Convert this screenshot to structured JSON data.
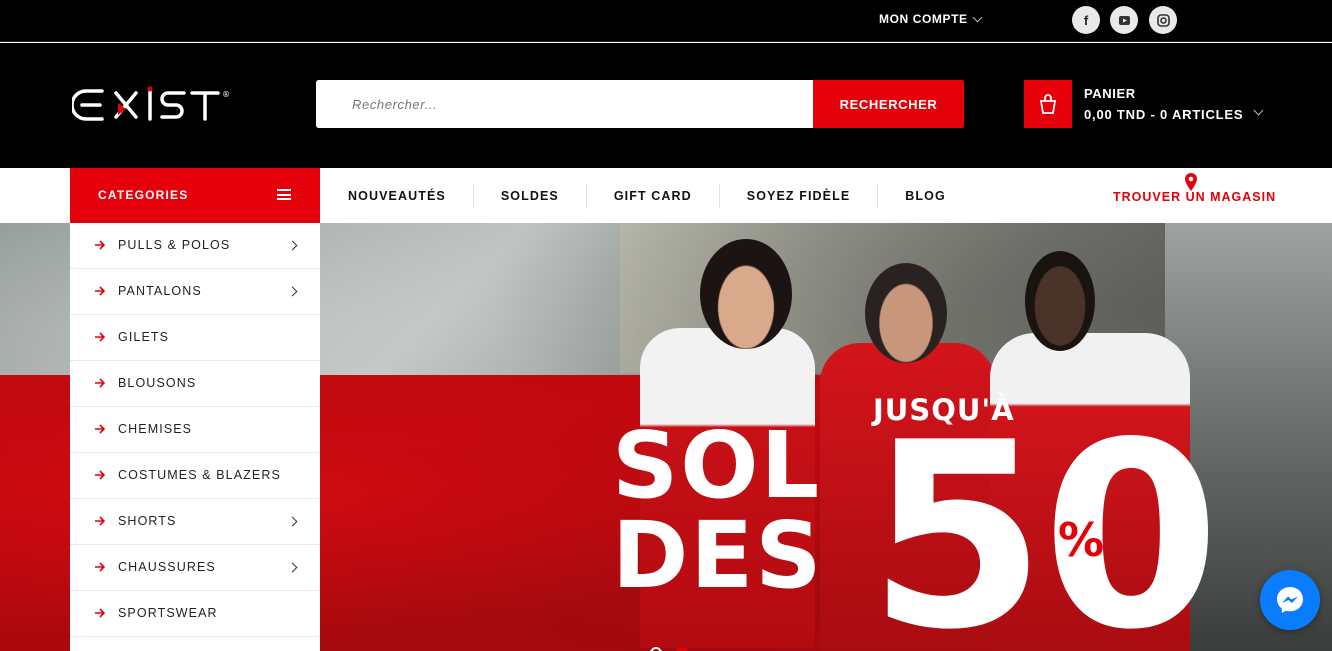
{
  "topbar": {
    "account_label": "MON COMPTE",
    "social": [
      {
        "icon": "facebook-icon",
        "glyph": "f"
      },
      {
        "icon": "youtube-icon",
        "glyph": "▶"
      },
      {
        "icon": "instagram-icon",
        "glyph": "◎"
      }
    ]
  },
  "header": {
    "logo_text": "EXIST",
    "search": {
      "placeholder": "Rechercher...",
      "button_label": "RECHERCHER"
    },
    "cart": {
      "title": "PANIER",
      "summary": "0,00 TND - 0 ARTICLES"
    }
  },
  "nav": {
    "categories_label": "CATEGORIES",
    "items": [
      "NOUVEAUTÉS",
      "SOLDES",
      "GIFT CARD",
      "SOYEZ FIDÈLE",
      "BLOG"
    ],
    "store_label": "TROUVER UN MAGASIN"
  },
  "categories": [
    {
      "label": "PULLS & POLOS",
      "has_sub": true
    },
    {
      "label": "PANTALONS",
      "has_sub": true
    },
    {
      "label": "GILETS",
      "has_sub": false
    },
    {
      "label": "BLOUSONS",
      "has_sub": false
    },
    {
      "label": "CHEMISES",
      "has_sub": false
    },
    {
      "label": "COSTUMES & BLAZERS",
      "has_sub": false
    },
    {
      "label": "SHORTS",
      "has_sub": true
    },
    {
      "label": "CHAUSSURES",
      "has_sub": true
    },
    {
      "label": "SPORTSWEAR",
      "has_sub": false
    }
  ],
  "hero": {
    "promo_top": "JUSQU'À",
    "promo_line1": "SOL",
    "promo_line2": "DES",
    "promo_number": "50",
    "promo_percent": "%",
    "slides": 2,
    "active_slide": 1
  },
  "colors": {
    "brand_red": "#e4010b",
    "messenger_blue": "#0a7cff"
  }
}
